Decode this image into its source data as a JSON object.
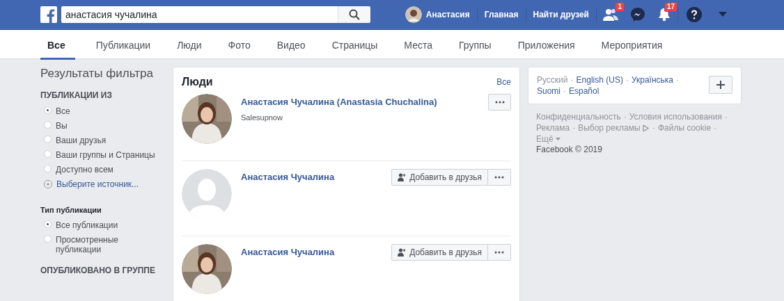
{
  "topbar": {
    "search": {
      "value": "анастасия чучалина"
    },
    "profile": {
      "name": "Анастасия"
    },
    "links": [
      "Главная",
      "Найти друзей"
    ],
    "badges": {
      "friends": "1",
      "notifications": "17"
    }
  },
  "tabs": [
    {
      "label": "Все",
      "selected": true
    },
    {
      "label": "Публикации",
      "selected": false
    },
    {
      "label": "Люди",
      "selected": false
    },
    {
      "label": "Фото",
      "selected": false
    },
    {
      "label": "Видео",
      "selected": false
    },
    {
      "label": "Страницы",
      "selected": false
    },
    {
      "label": "Места",
      "selected": false
    },
    {
      "label": "Группы",
      "selected": false
    },
    {
      "label": "Приложения",
      "selected": false
    },
    {
      "label": "Мероприятия",
      "selected": false
    }
  ],
  "filters": {
    "title": "Результаты фильтра",
    "sections": [
      {
        "heading": "ПУБЛИКАЦИИ ИЗ",
        "kind": "caps",
        "options": [
          {
            "label": "Все",
            "selected": true
          },
          {
            "label": "Вы",
            "selected": false
          },
          {
            "label": "Ваши друзья",
            "selected": false
          },
          {
            "label": "Ваши группы и Страницы",
            "selected": false
          },
          {
            "label": "Доступно всем",
            "selected": false
          }
        ],
        "add_link": "Выберите источник..."
      },
      {
        "heading": "Тип публикации",
        "kind": "bold",
        "options": [
          {
            "label": "Все публикации",
            "selected": true
          },
          {
            "label": "Просмотренные публикации",
            "selected": false
          }
        ]
      },
      {
        "heading": "ОПУБЛИКОВАНО В ГРУППЕ",
        "kind": "caps"
      }
    ]
  },
  "people": {
    "title": "Люди",
    "see_all": "Все",
    "results": [
      {
        "name": "Анастасия Чучалина (Anastasia Chuchalina)",
        "subtitle": "Salesupnow",
        "kind": "picture"
      },
      {
        "name": "Анастасия Чучалина",
        "kind": "placeholder",
        "add_button": "Добавить в друзья"
      },
      {
        "name": "Анастасия Чучалина",
        "kind": "picture",
        "add_button": "Добавить в друзья"
      }
    ]
  },
  "languages": {
    "current": "Русский",
    "separator": "·",
    "others": [
      "English (US)",
      "Українська",
      "Suomi",
      "Español"
    ]
  },
  "footer": {
    "separator": "·",
    "links": [
      "Конфиденциальность",
      "Условия использования",
      "Реклама",
      "Выбор рекламы",
      "Файлы cookie",
      "Ещё"
    ],
    "copyright": "Facebook © 2019"
  }
}
